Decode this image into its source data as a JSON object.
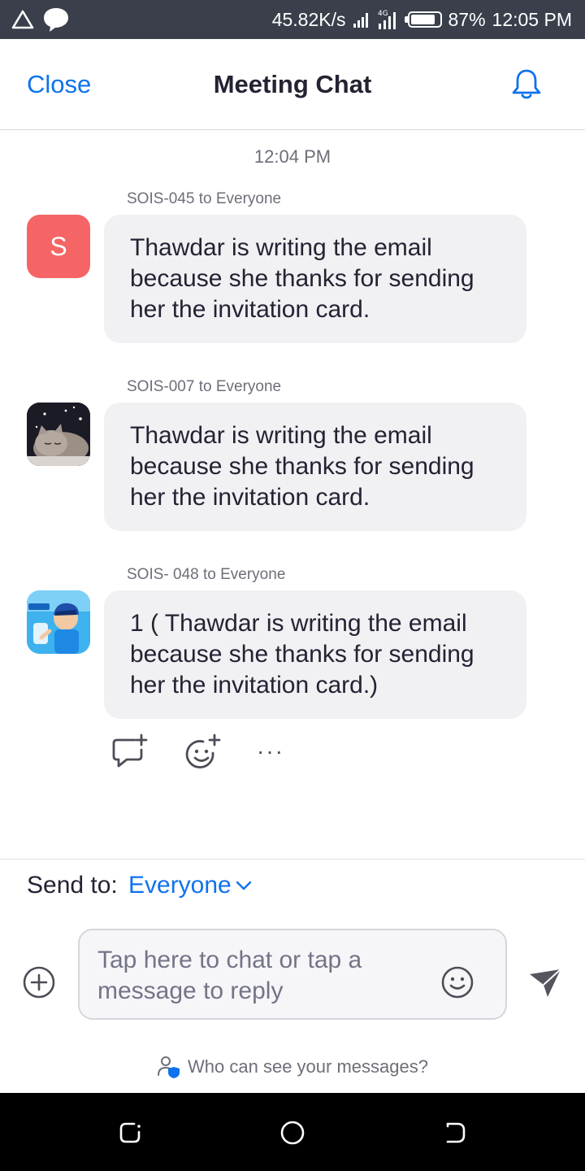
{
  "status_bar": {
    "speed": "45.82K/s",
    "network": "4G",
    "battery": "87%",
    "battery_level": 0.87,
    "time": "12:05 PM"
  },
  "header": {
    "close_label": "Close",
    "title": "Meeting Chat"
  },
  "chat": {
    "timestamp": "12:04 PM",
    "messages": [
      {
        "sender": "SOIS-045 to Everyone",
        "avatar_letter": "S",
        "avatar_color": "#f56565",
        "lines": [
          "Thawdar is writing the email",
          "because she thanks for sending",
          "her the invitation card."
        ]
      },
      {
        "sender": "SOIS-007 to Everyone",
        "avatar_icon": "kitten-photo",
        "lines": [
          "Thawdar is writing the email",
          "because she thanks for sending",
          "her the invitation card."
        ]
      },
      {
        "sender": "SOIS- 048 to Everyone",
        "avatar_icon": "cartoon-boy-photo",
        "lines": [
          "1 ( Thawdar is writing the email",
          "because she thanks for sending",
          "her the invitation card.)"
        ]
      }
    ],
    "actions": {
      "more_label": "···"
    }
  },
  "composer": {
    "send_to_label": "Send to:",
    "send_to_value": "Everyone",
    "placeholder_line1": "Tap here to chat or tap a",
    "placeholder_line2": "message to reply",
    "privacy_label": "Who can see your messages?"
  },
  "colors": {
    "accent": "#0e72ed",
    "bubble": "#f1f1f4",
    "status_bar": "#3a3f4b"
  }
}
